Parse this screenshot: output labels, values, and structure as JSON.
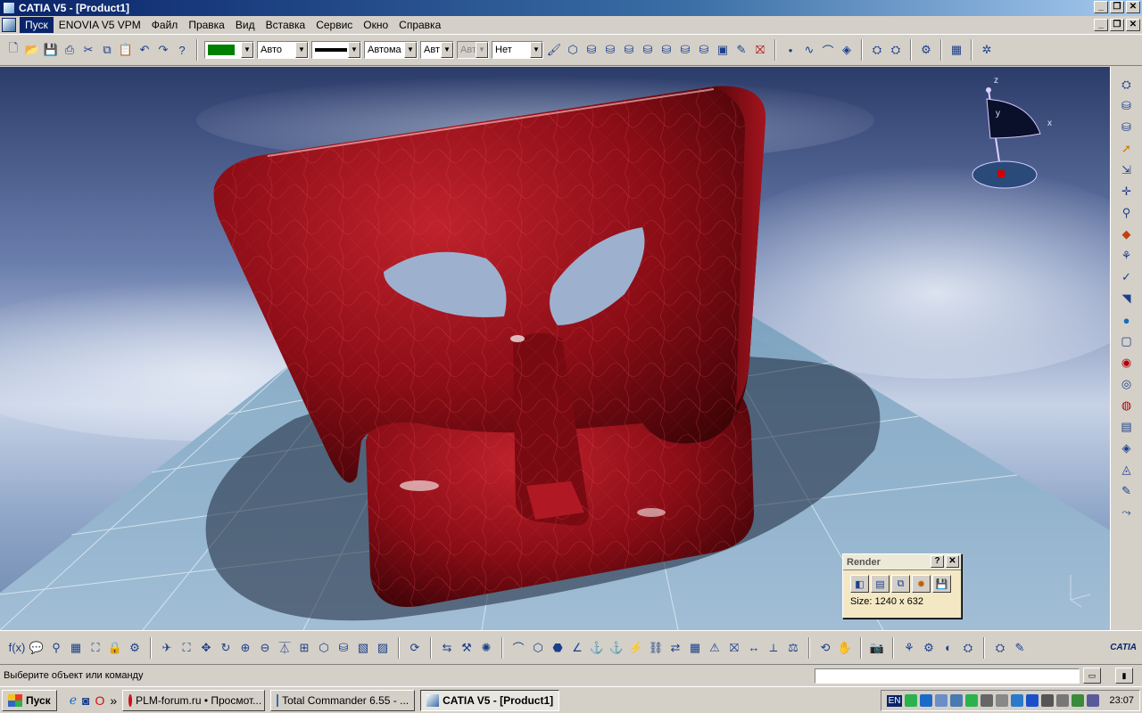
{
  "window": {
    "title": "CATIA V5 - [Product1]"
  },
  "menu": {
    "items": [
      "Пуск",
      "ENOVIA V5 VPM",
      "Файл",
      "Правка",
      "Вид",
      "Вставка",
      "Сервис",
      "Окно",
      "Справка"
    ]
  },
  "toolbar": {
    "line_type_value": "Авто",
    "thickness_value": "Автома",
    "point_type_value": "Авт",
    "layer_value": "Авт",
    "transparency_value": "Нет",
    "fill_color": "#008000"
  },
  "viewport": {
    "sky_colors": [
      "#2c3c6a",
      "#c7d2e6"
    ],
    "model_color": "#8b0d16",
    "compass_labels": {
      "z": "z",
      "y": "y",
      "x": "x"
    }
  },
  "render_dialog": {
    "title": "Render",
    "help_label": "?",
    "close_label": "✕",
    "size_text": "Size: 1240 x 632"
  },
  "statusbar": {
    "message": "Выберите объект или команду"
  },
  "bottom": {
    "logo_text": "CATIA"
  },
  "taskbar": {
    "start_label": "Пуск",
    "more_label": "»",
    "tasks": [
      {
        "label": "PLM-forum.ru • Просмот...",
        "active": false
      },
      {
        "label": "Total Commander 6.55 - ...",
        "active": false
      },
      {
        "label": "CATIA V5 - [Product1]",
        "active": true
      }
    ],
    "lang": "EN",
    "clock": "23:07"
  }
}
